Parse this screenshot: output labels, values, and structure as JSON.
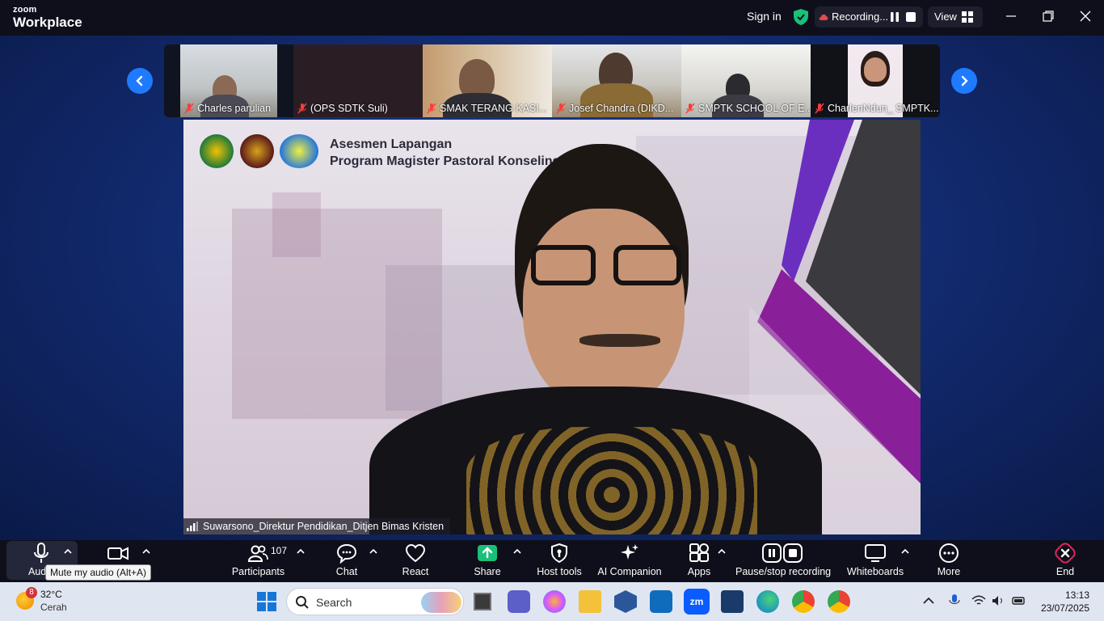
{
  "app": {
    "brand_top": "zoom",
    "brand_bottom": "Workplace"
  },
  "topbar": {
    "sign_in": "Sign in",
    "recording": "Recording...",
    "view": "View"
  },
  "participants_strip": [
    {
      "name": "Charles parulian"
    },
    {
      "name": "(OPS SDTK Suli)"
    },
    {
      "name": "SMAK TERANG KASI..."
    },
    {
      "name": "Josef Chandra (DIKD..."
    },
    {
      "name": "SMPTK SCHOOL OF E..."
    },
    {
      "name": "CharlenNdun_ SMPTK..."
    }
  ],
  "main_video": {
    "slide_title_line1": "Asesmen Lapangan",
    "slide_title_line2": "Program Magister Pastoral Konseling",
    "speaker_name": "Suwarsono_Direktur Pendidikan_Ditjen Bimas Kristen"
  },
  "toolbar": {
    "audio": "Audio",
    "tooltip": "Mute my audio (Alt+A)",
    "participants": "Participants",
    "participants_count": "107",
    "chat": "Chat",
    "react": "React",
    "share": "Share",
    "host_tools": "Host tools",
    "ai_companion": "AI Companion",
    "apps": "Apps",
    "pause_stop": "Pause/stop recording",
    "whiteboards": "Whiteboards",
    "more": "More",
    "end": "End"
  },
  "taskbar": {
    "weather_badge": "8",
    "temperature": "32°C",
    "condition": "Cerah",
    "search_placeholder": "Search",
    "time": "13:13",
    "date": "23/07/2025"
  },
  "colors": {
    "accent": "#1e7bff",
    "share_green": "#19c07a",
    "end_red": "#e0245e",
    "recording_red": "#e5484d"
  }
}
